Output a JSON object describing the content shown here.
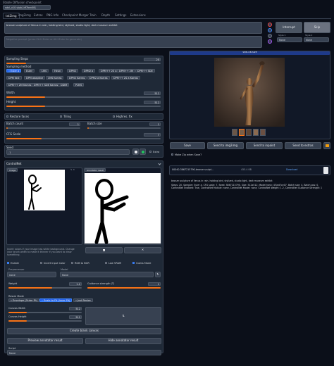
{
  "checkpoint": {
    "label": "Stable Diffusion checkpoint",
    "value": "sdxl_v10.vlpb [df7bed0f]"
  },
  "tabs": [
    "txt2img",
    "img2img",
    "Extras",
    "PNG Info",
    "Checkpoint Merger",
    "Train",
    "Depth",
    "Settings",
    "Extensions"
  ],
  "prompt": {
    "value": "bronze sculpture of Venus in rain, holding bird, stylized, studio light, dark museum exhibit",
    "negative_placeholder": "Negative prompt (press Ctrl+Enter or Alt+Enter to generate)"
  },
  "right_buttons": {
    "interrupt": "Interrupt",
    "skip": "Skip",
    "styles_label": "Style 1",
    "styles_label2": "Style 2",
    "style_value": "None"
  },
  "sampling": {
    "steps_label": "Sampling Steps",
    "steps_value": "20",
    "method_label": "Sampling method",
    "methods": [
      "Euler a",
      "Euler",
      "LMS",
      "Heun",
      "DPM2",
      "DPM2 a",
      "DPM++ 2S a",
      "DPM++ 2M",
      "DPM++ SDE",
      "DPM fast",
      "DPM adaptive",
      "LMS Karras",
      "DPM2 Karras",
      "DPM2 a Karras",
      "DPM++ 2S a Karras",
      "DPM++ 2M Karras",
      "DPM++ SDE Karras",
      "DDIM",
      "PLMS"
    ],
    "selected": "Euler a"
  },
  "size": {
    "width_label": "Width",
    "width_value": "512",
    "height_label": "Height",
    "height_value": "512"
  },
  "options": {
    "restore_faces": "Restore faces",
    "tiling": "Tiling",
    "hires_fix": "Highres. fix"
  },
  "batch": {
    "count_label": "Batch count",
    "count_value": "1",
    "size_label": "Batch size",
    "size_value": "1"
  },
  "cfg": {
    "label": "CFG Scale",
    "value": "7"
  },
  "seed": {
    "label": "Seed",
    "value": "-1",
    "extra": "Extra"
  },
  "controlnet": {
    "title": "ControlNet",
    "image_label": "Image",
    "annotator_label": "Annotator result",
    "note": "Invert colors if your image has white background. Change your brush width to make it thinner if you want to draw something.",
    "enable": "Enable",
    "invert": "Invert Input Color",
    "rgb_bgr": "RGB to BGR",
    "low_vram": "Low VRAM",
    "guess": "Guess Mode",
    "preprocessor_label": "Preprocessor",
    "preprocessor_value": "none",
    "model_label": "Model",
    "model_value": "None",
    "weight_label": "Weight",
    "weight_value": "1.2",
    "guidance_label": "Guidance strength (T)",
    "guidance_value": "1",
    "resize_label": "Resize Mode",
    "resize_options": [
      "Envelope (Outer Fit)",
      "Scale to Fit (Inner Fit)",
      "Just Resize"
    ],
    "canvas_width_label": "Canvas Width",
    "canvas_width_value": "512",
    "canvas_height_label": "Canvas Height",
    "canvas_height_value": "512",
    "create_canvas": "Create blank canvas",
    "preview": "Preview annotator result",
    "hide": "Hide annotator result"
  },
  "script": {
    "label": "Script",
    "value": "None"
  },
  "output": {
    "header": "SPIN-OB-SIZE",
    "buttons": [
      "Save",
      "Send to img2img",
      "Send to inpaint",
      "Send to extras"
    ],
    "zip_label": "Make Zip when Save?",
    "file_name": "00040-3867215790-bronze sculpt...",
    "file_size": "455.4 KB",
    "download": "Download",
    "info_prompt": "bronze sculpture of Venus in rain, holding bird, stylized, studio light, dark museum exhibit",
    "info_params": "Steps: 20, Sampler: Euler a, CFG scale: 7, Seed: 3867215790, Size: 512x512, Model hash: 4f1ed7ce07, Batch size: 4, Batch pos: 0, ControlNet Enabled: True, ControlNet Module: none, ControlNet Model: none, ControlNet Weight: 1.2, ControlNet Guidance Strength: 1"
  },
  "colors": {
    "accent": "#f97316",
    "primary": "#2563eb",
    "bg": "#0b0f19",
    "panel": "#1f2937"
  }
}
